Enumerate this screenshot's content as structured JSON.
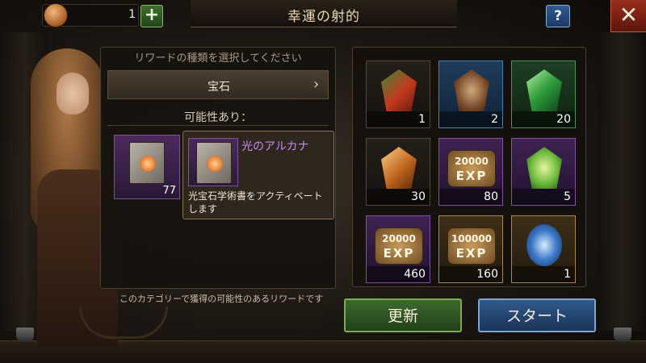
{
  "header": {
    "title": "幸運の射的",
    "coin_value": "1",
    "add_label": "+",
    "help_label": "?",
    "close_label": "✕"
  },
  "left_panel": {
    "header": "リワードの種類を選択してください",
    "category": "宝石",
    "possible_label": "可能性あり：",
    "item_qty": "77",
    "footer": "このカテゴリーで獲得の可能性のあるリワードです"
  },
  "tooltip": {
    "name": "光のアルカナ",
    "description": "光宝石学術書をアクティベートします"
  },
  "rewards": [
    {
      "icon": "red-crystal-icon",
      "rarity": "gray",
      "qty": "1"
    },
    {
      "icon": "dragon-gem-icon",
      "rarity": "blue",
      "qty": "2"
    },
    {
      "icon": "green-gem-icon",
      "rarity": "green",
      "qty": "20"
    },
    {
      "icon": "amber-gem-icon",
      "rarity": "gray",
      "qty": "30"
    },
    {
      "icon": "exp-badge-icon",
      "rarity": "purple",
      "exp_value": "20000",
      "exp_label": "EXP",
      "qty": "80"
    },
    {
      "icon": "green-crystal-icon",
      "rarity": "purple",
      "qty": "5"
    },
    {
      "icon": "exp-badge-icon",
      "rarity": "purple",
      "exp_value": "20000",
      "exp_label": "EXP",
      "qty": "460"
    },
    {
      "icon": "exp-badge-icon",
      "rarity": "gold",
      "exp_value": "100000",
      "exp_label": "EXP",
      "qty": "160"
    },
    {
      "icon": "blue-gem-icon",
      "rarity": "gold",
      "qty": "1"
    }
  ],
  "buttons": {
    "refresh": "更新",
    "start": "スタート"
  }
}
